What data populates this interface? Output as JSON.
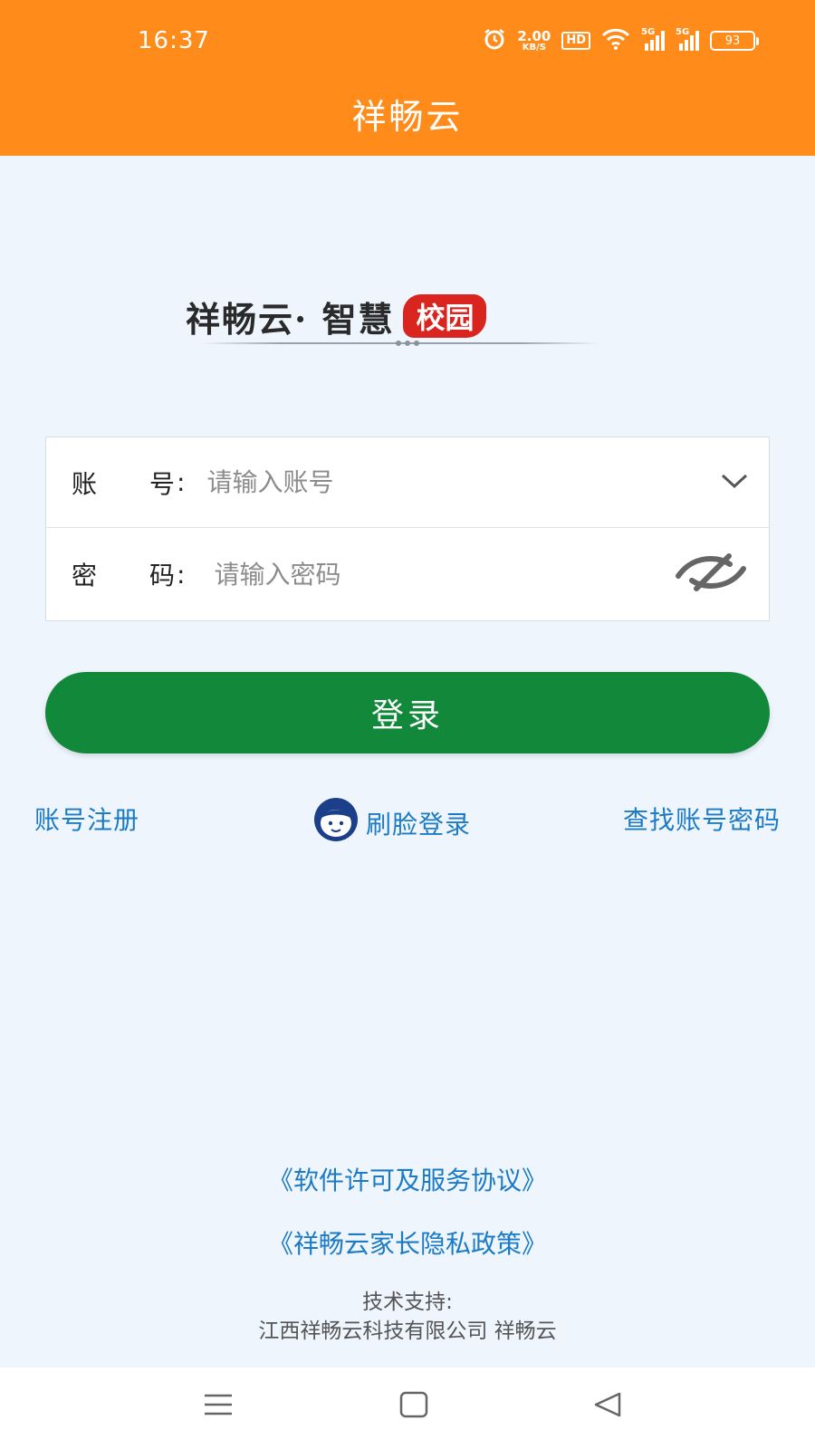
{
  "status_bar": {
    "time": "16:37",
    "net_speed": "2.00",
    "net_unit": "KB/S",
    "hd": "HD",
    "sim1": "5G",
    "sim2": "5G",
    "battery": "93"
  },
  "header": {
    "title": "祥畅云"
  },
  "logo": {
    "text": "祥畅云· 智慧",
    "badge": "校园"
  },
  "login_form": {
    "account_label": [
      "账",
      "号"
    ],
    "password_label": [
      "密",
      "码"
    ],
    "colon": ":",
    "account_placeholder": "请输入账号",
    "password_placeholder": "请输入密码",
    "account_value": "",
    "password_value": ""
  },
  "login_button": "登录",
  "links": {
    "register": "账号注册",
    "face_login": "刷脸登录",
    "find_password": "查找账号密码"
  },
  "agreements": {
    "license": "《软件许可及服务协议》",
    "privacy": "《祥畅云家长隐私政策》"
  },
  "support": {
    "label": "技术支持:",
    "company": "江西祥畅云科技有限公司 祥畅云"
  },
  "colors": {
    "header": "#ff8c1a",
    "login_button": "#12883a",
    "link": "#1c7bc4",
    "background": "#eef5fc"
  }
}
